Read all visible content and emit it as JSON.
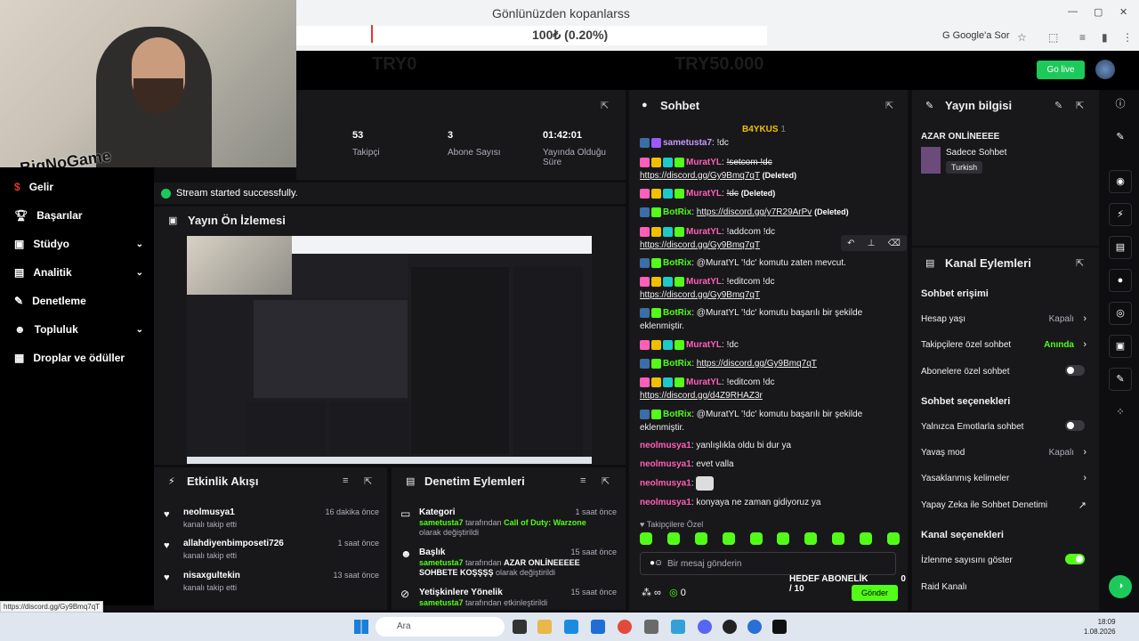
{
  "browser": {
    "page_title": "Gönlünüzden kopanlarss",
    "amount": "100₺ (0.20%)",
    "google_search": "Google'a Sor"
  },
  "header": {
    "ghost_left": "TRY0",
    "ghost_right": "TRY50.000",
    "go_live": "Go live"
  },
  "webcam": {
    "overlay_logo": "BigNoGame"
  },
  "sidebar": {
    "items": [
      {
        "label": "Gelir",
        "icon": "money-icon"
      },
      {
        "label": "Başarılar",
        "icon": "trophy-icon"
      },
      {
        "label": "Stüdyo",
        "icon": "studio-icon"
      },
      {
        "label": "Analitik",
        "icon": "chart-icon"
      },
      {
        "label": "Denetleme",
        "icon": "wrench-icon"
      },
      {
        "label": "Topluluk",
        "icon": "people-icon"
      },
      {
        "label": "Droplar ve ödüller",
        "icon": "gift-icon"
      }
    ]
  },
  "stats": [
    {
      "value": "53",
      "label": "Takipçi"
    },
    {
      "value": "3",
      "label": "Abone Sayısı"
    },
    {
      "value": "01:42:01",
      "label": "Yayında Olduğu Süre"
    }
  ],
  "toast": "Stream started successfully.",
  "preview": {
    "title": "Yayın Ön İzlemesi"
  },
  "activity": {
    "title": "Etkinlik Akışı",
    "items": [
      {
        "name": "neolmusya1",
        "desc": "kanalı takip etti",
        "time": "16 dakika önce"
      },
      {
        "name": "allahdiyenbimposeti726",
        "desc": "kanalı takip etti",
        "time": "1 saat önce"
      },
      {
        "name": "nisaxgultekin",
        "desc": "kanalı takip etti",
        "time": "13 saat önce"
      }
    ]
  },
  "moderation": {
    "title": "Denetim Eylemleri",
    "items": [
      {
        "title": "Kategori",
        "user": "sametusta7",
        "mid": " tarafından ",
        "value": "Call of Duty: Warzone",
        "tail": " olarak değiştirildi",
        "time": "1 saat önce"
      },
      {
        "title": "Başlık",
        "user": "sametusta7",
        "mid": " tarafından ",
        "value": "AZAR ONLİNEEEEE SOHBETE KOŞŞŞŞ",
        "tail": " olarak değiştirildi",
        "time": "15 saat önce"
      },
      {
        "title": "Yetişkinlere Yönelik",
        "user": "sametusta7",
        "mid": " tarafından etkinleştirildi",
        "value": "",
        "tail": "",
        "time": "15 saat önce"
      }
    ]
  },
  "chat": {
    "title": "Sohbet",
    "pinned_user": "B4YKUS",
    "pinned_count": "1",
    "messages": [
      {
        "user": "sametusta7",
        "text": "!dc",
        "color": "purple"
      },
      {
        "user": "MuratYL",
        "text": "!setcom !dc",
        "link": "https://discord.gg/Gy9Bmq7qT",
        "deleted": "(Deleted)",
        "color": "pink"
      },
      {
        "user": "MuratYL",
        "text": "!dc",
        "deleted": "(Deleted)",
        "color": "pink"
      },
      {
        "user": "BotRix",
        "link": "https://discord.gg/y7R29ArPv",
        "deleted": "(Deleted)",
        "color": "green"
      },
      {
        "user": "MuratYL",
        "text": "!addcom !dc",
        "link": "https://discord.gg/Gy9Bmq7qT",
        "color": "pink"
      },
      {
        "user": "BotRix",
        "text": "@MuratYL '!dc' komutu zaten mevcut.",
        "color": "green"
      },
      {
        "user": "MuratYL",
        "text": "!editcom !dc",
        "link": "https://discord.gg/Gy9Bmq7qT",
        "color": "pink"
      },
      {
        "user": "BotRix",
        "text": "@MuratYL '!dc' komutu başarılı bir şekilde eklenmiştir.",
        "color": "green"
      },
      {
        "user": "MuratYL",
        "text": "!dc",
        "color": "pink"
      },
      {
        "user": "BotRix",
        "link": "https://discord.gg/Gy9Bmq7qT",
        "color": "green"
      },
      {
        "user": "MuratYL",
        "text": "!editcom !dc",
        "link": "https://discord.gg/d4Z9RHAZ3r",
        "color": "pink"
      },
      {
        "user": "BotRix",
        "text": "@MuratYL '!dc' komutu başarılı bir şekilde eklenmiştir.",
        "color": "green"
      },
      {
        "user": "neolmusya1",
        "text": "yanlışlıkla oldu bi dur ya",
        "color": "pink"
      },
      {
        "user": "neolmusya1",
        "text": "evet valla",
        "color": "pink"
      },
      {
        "user": "neolmusya1",
        "text": "",
        "color": "pink"
      },
      {
        "user": "neolmusya1",
        "text": "konyaya ne zaman gidiyoruz ya",
        "color": "pink"
      }
    ],
    "followers_only": "Takipçilere Özel",
    "input_placeholder": "Bir mesaj gönderin",
    "viewer_count": "0",
    "goal_label": "HEDEF ABONELİK",
    "goal_count": "0 / 10",
    "send": "Gönder"
  },
  "info": {
    "title": "Yayın bilgisi",
    "stream_title": "AZAR ONLİNEEEE",
    "category": "Sadece Sohbet",
    "tag": "Turkish"
  },
  "actions": {
    "title": "Kanal Eylemleri",
    "chat_access": "Sohbet erişimi",
    "account_age": "Hesap yaşı",
    "account_age_val": "Kapalı",
    "followers_chat": "Takipçilere özel sohbet",
    "followers_chat_val": "Anında",
    "subs_chat": "Abonelere özel sohbet",
    "chat_options": "Sohbet seçenekleri",
    "emote_only": "Yalnızca Emotlarla sohbet",
    "slow_mode": "Yavaş mod",
    "slow_mode_val": "Kapalı",
    "banned_words": "Yasaklanmış kelimeler",
    "ai_mod": "Yapay Zeka ile Sohbet Denetimi",
    "channel_options": "Kanal seçenekleri",
    "show_viewers": "İzlenme sayısını göster",
    "raid": "Raid Kanalı"
  },
  "status_url": "https://discord.gg/Gy9Bmq7qT",
  "taskbar": {
    "search": "Ara",
    "time": "18:09",
    "date": "1.08.2026"
  }
}
